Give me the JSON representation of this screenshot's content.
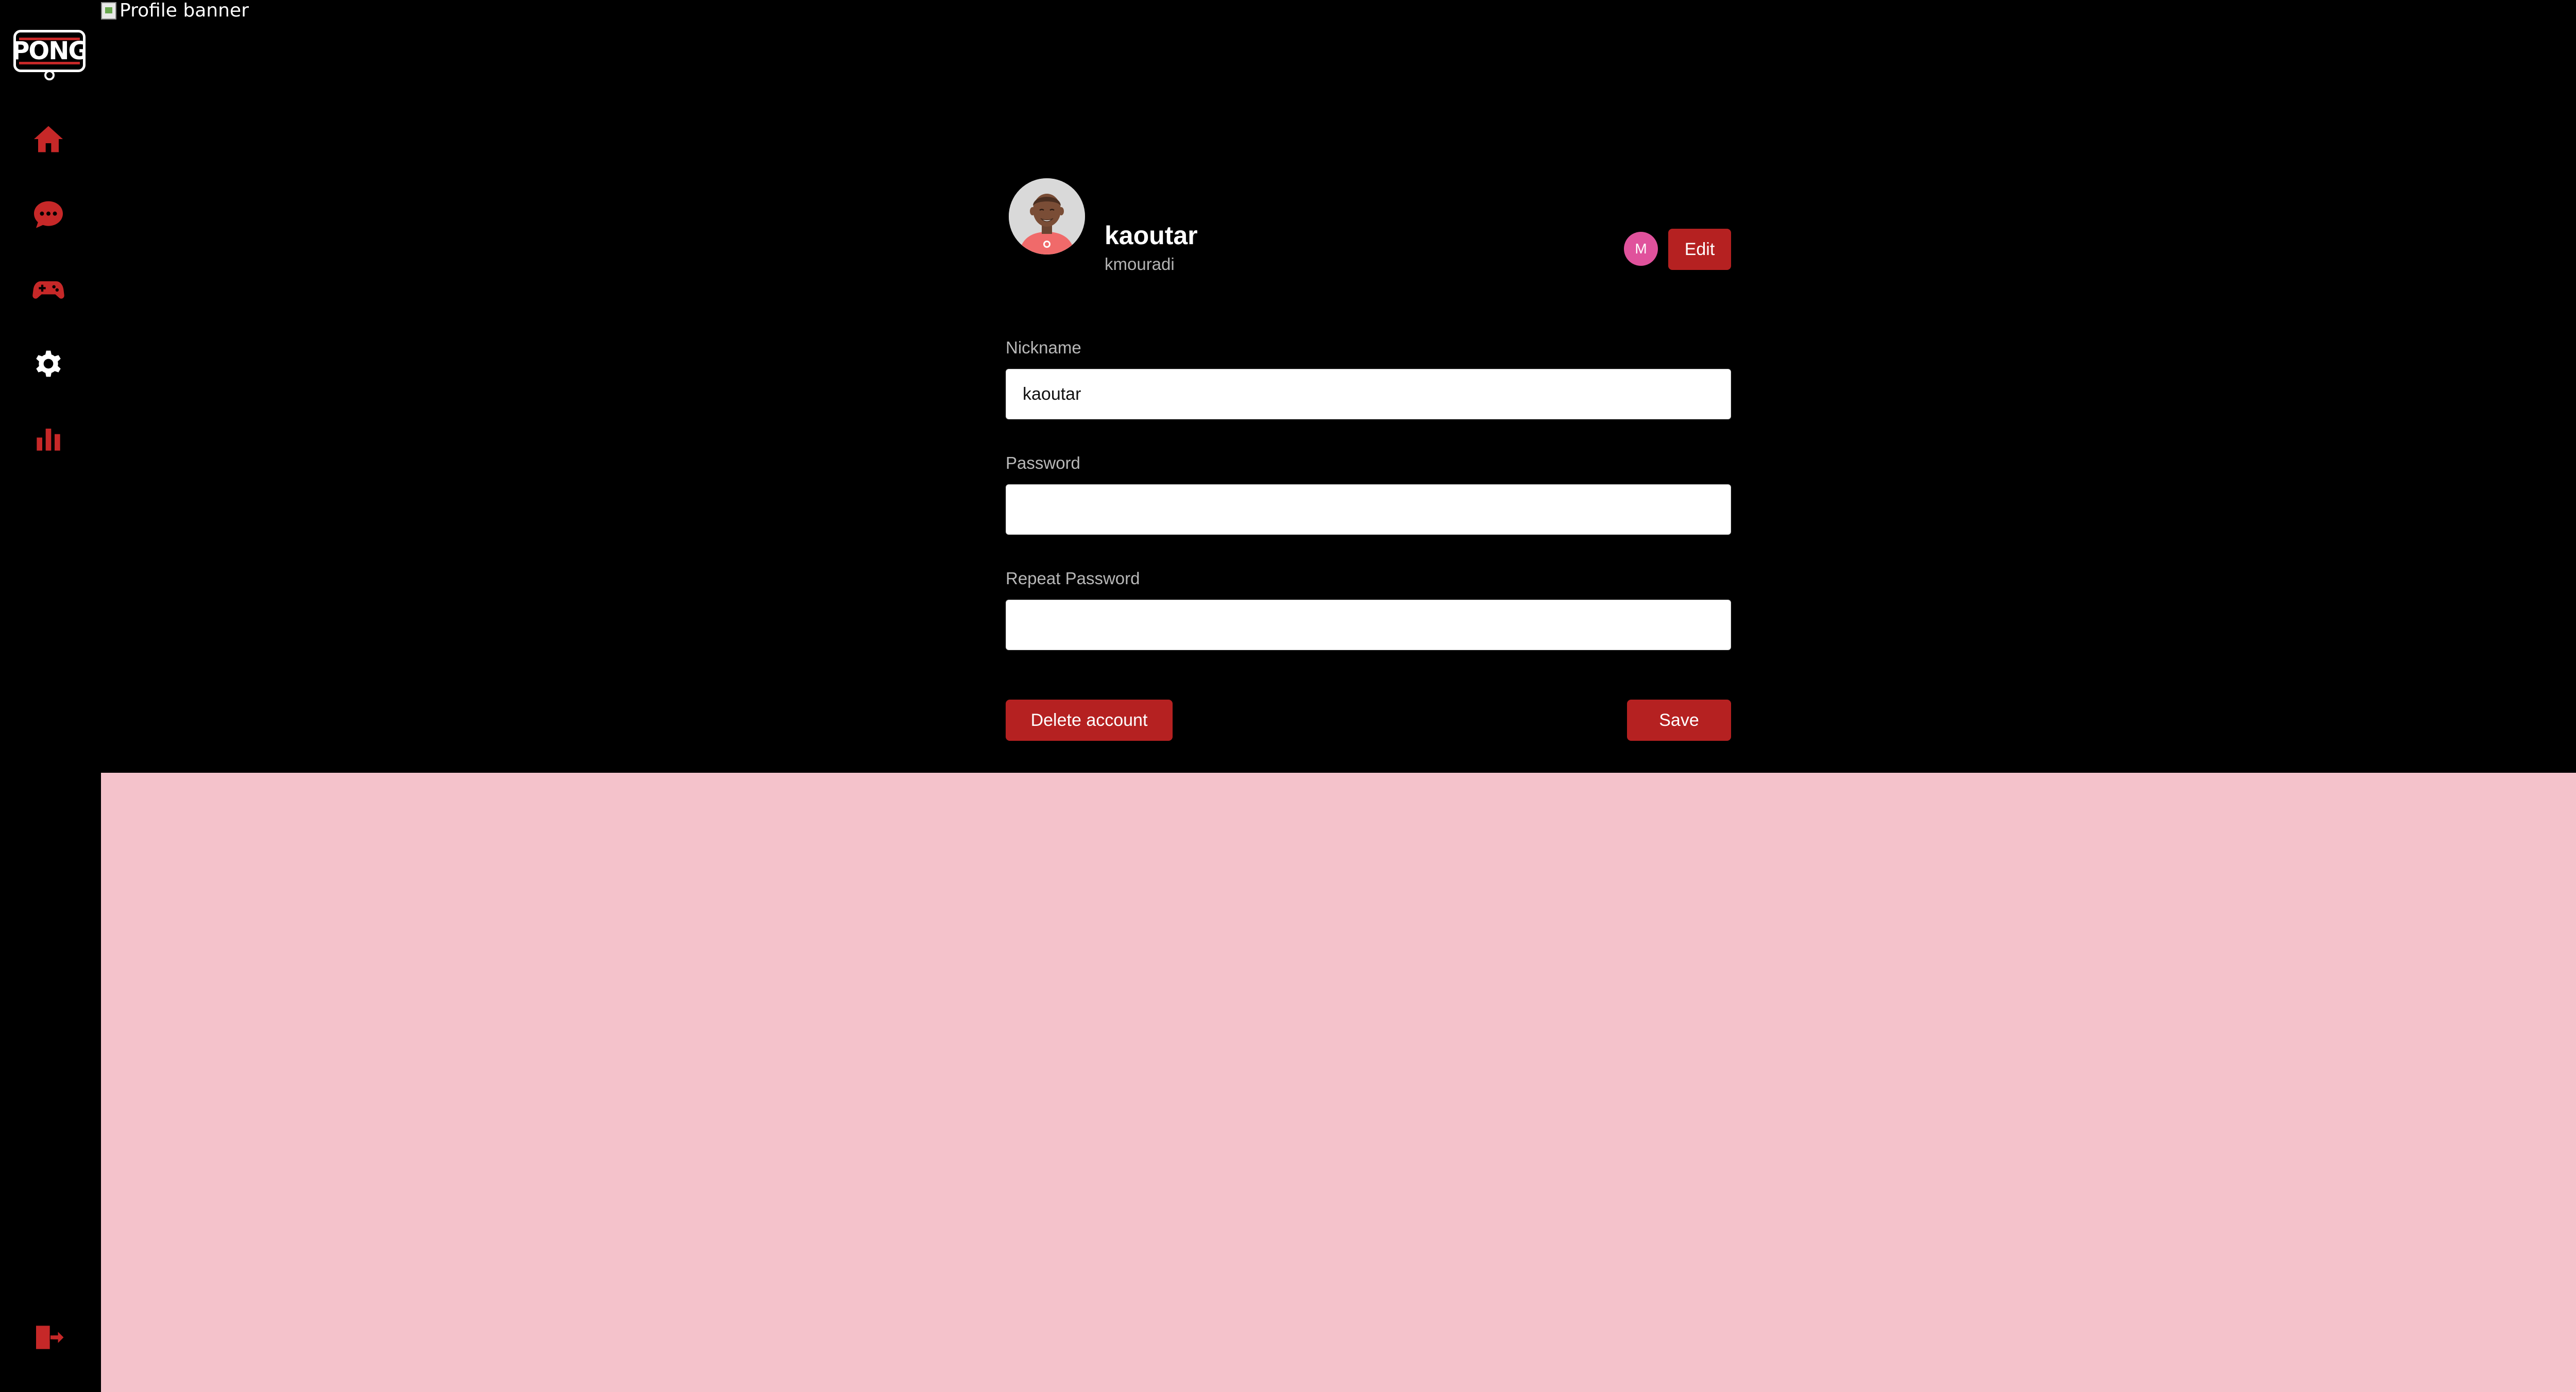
{
  "app": {
    "logo_text": "PONG"
  },
  "sidebar": {
    "items": [
      {
        "icon": "home-icon"
      },
      {
        "icon": "chat-icon"
      },
      {
        "icon": "gamepad-icon"
      },
      {
        "icon": "gear-icon",
        "active": true
      },
      {
        "icon": "stats-icon"
      }
    ],
    "logout_icon": "logout-icon",
    "accent_color": "#c62828",
    "active_color": "#ffffff"
  },
  "banner": {
    "alt_text": "Profile banner"
  },
  "profile": {
    "name": "kaoutar",
    "login": "kmouradi",
    "badge_letter": "M",
    "edit_label": "Edit"
  },
  "form": {
    "nickname_label": "Nickname",
    "nickname_value": "kaoutar",
    "password_label": "Password",
    "password_value": "",
    "repeat_password_label": "Repeat Password",
    "repeat_password_value": "",
    "delete_label": "Delete account",
    "save_label": "Save"
  },
  "colors": {
    "button": "#b52121",
    "lower_background": "#f4c2cb",
    "badge": "#e0529c"
  }
}
